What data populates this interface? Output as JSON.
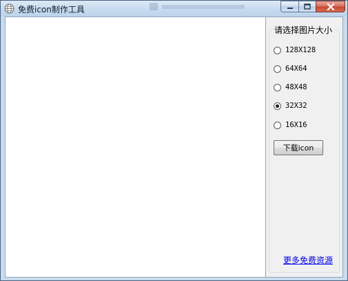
{
  "window": {
    "title": "免费icon制作工具"
  },
  "icons": {
    "app": "globe-icon",
    "minimize": "minimize-icon",
    "maximize": "maximize-icon",
    "close": "close-icon"
  },
  "sizes": {
    "legend": "请选择图片大小",
    "options": [
      "128X128",
      "64X64",
      "48X48",
      "32X32",
      "16X16"
    ],
    "selected": "32X32"
  },
  "download_button": "下载icon",
  "more_link": "更多免费资源",
  "colors": {
    "titlebar": "#c7dbef",
    "close_button": "#c7452c",
    "link": "#0000ee",
    "panel": "#f0f0f0"
  }
}
